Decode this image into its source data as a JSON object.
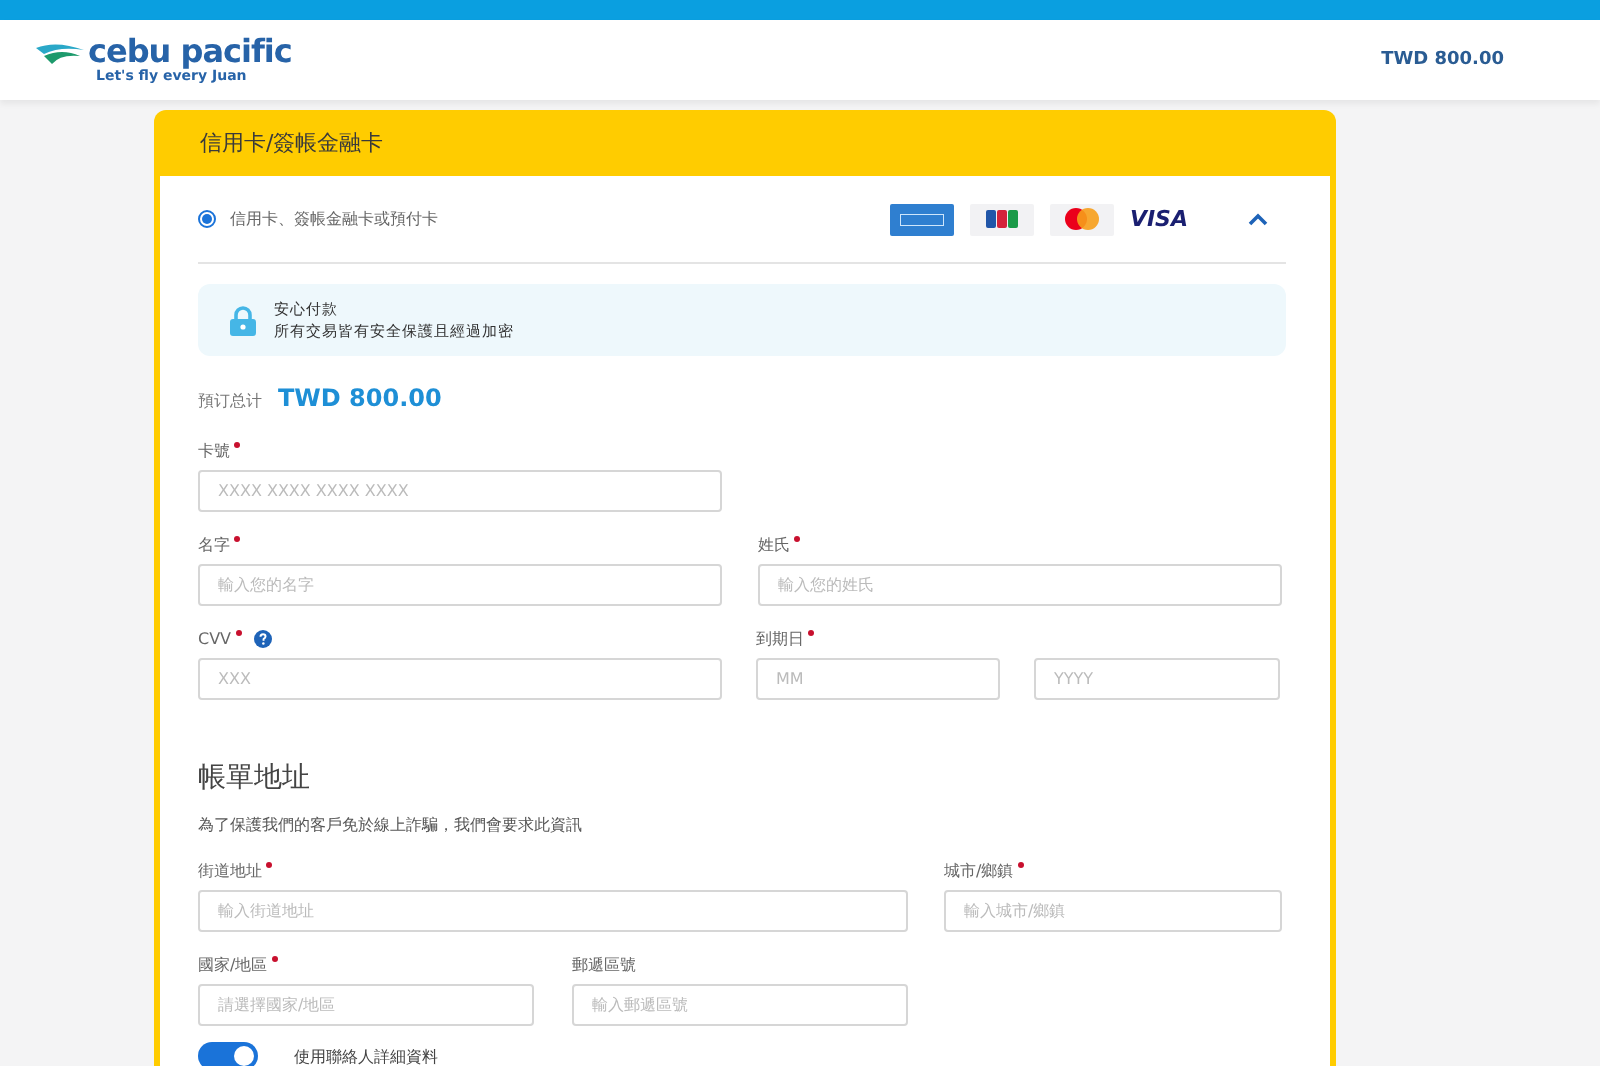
{
  "header": {
    "logo_text": "cebu pacific",
    "tagline": "Let's fly every Juan",
    "total": "TWD 800.00"
  },
  "payment": {
    "title": "信用卡/簽帳金融卡",
    "method": {
      "label": "信用卡、簽帳金融卡或預付卡",
      "selected": true,
      "expanded": true
    },
    "card_logos": [
      {
        "kind": "amex"
      },
      {
        "kind": "jcb"
      },
      {
        "kind": "mastercard"
      },
      {
        "kind": "visa",
        "text": "VISA"
      }
    ],
    "secure": {
      "title": "安心付款",
      "text": "所有交易皆有安全保護且經過加密"
    },
    "total": {
      "label": "預订总计",
      "amount": "TWD 800.00"
    },
    "card_fields": [
      {
        "label": "卡號",
        "required": true,
        "placeholder": "XXXX XXXX XXXX XXXX"
      },
      {
        "label": "名字",
        "required": true,
        "placeholder": "輸入您的名字"
      },
      {
        "label": "姓氏",
        "required": true,
        "placeholder": "輸入您的姓氏"
      },
      {
        "label": "CVV",
        "required": true,
        "placeholder": "XXX",
        "info": true
      },
      {
        "label": "到期日",
        "required": true,
        "placeholder": "MM"
      },
      {
        "required": false,
        "placeholder": "YYYY"
      }
    ]
  },
  "billing": {
    "title": "帳單地址",
    "description": "為了保護我們的客戶免於線上詐騙，我們會要求此資訊",
    "fields": [
      {
        "label": "街道地址",
        "required": true,
        "placeholder": "輸入街道地址"
      },
      {
        "label": "城市/鄉鎮",
        "required": true,
        "placeholder": "輸入城市/鄉鎮"
      },
      {
        "label": "國家/地區",
        "required": true,
        "placeholder": "請選擇國家/地區"
      },
      {
        "label": "郵遞區號",
        "required": false,
        "placeholder": "輸入郵遞區號"
      }
    ],
    "use_contact": {
      "label": "使用聯絡人詳細資料",
      "on": true
    }
  }
}
